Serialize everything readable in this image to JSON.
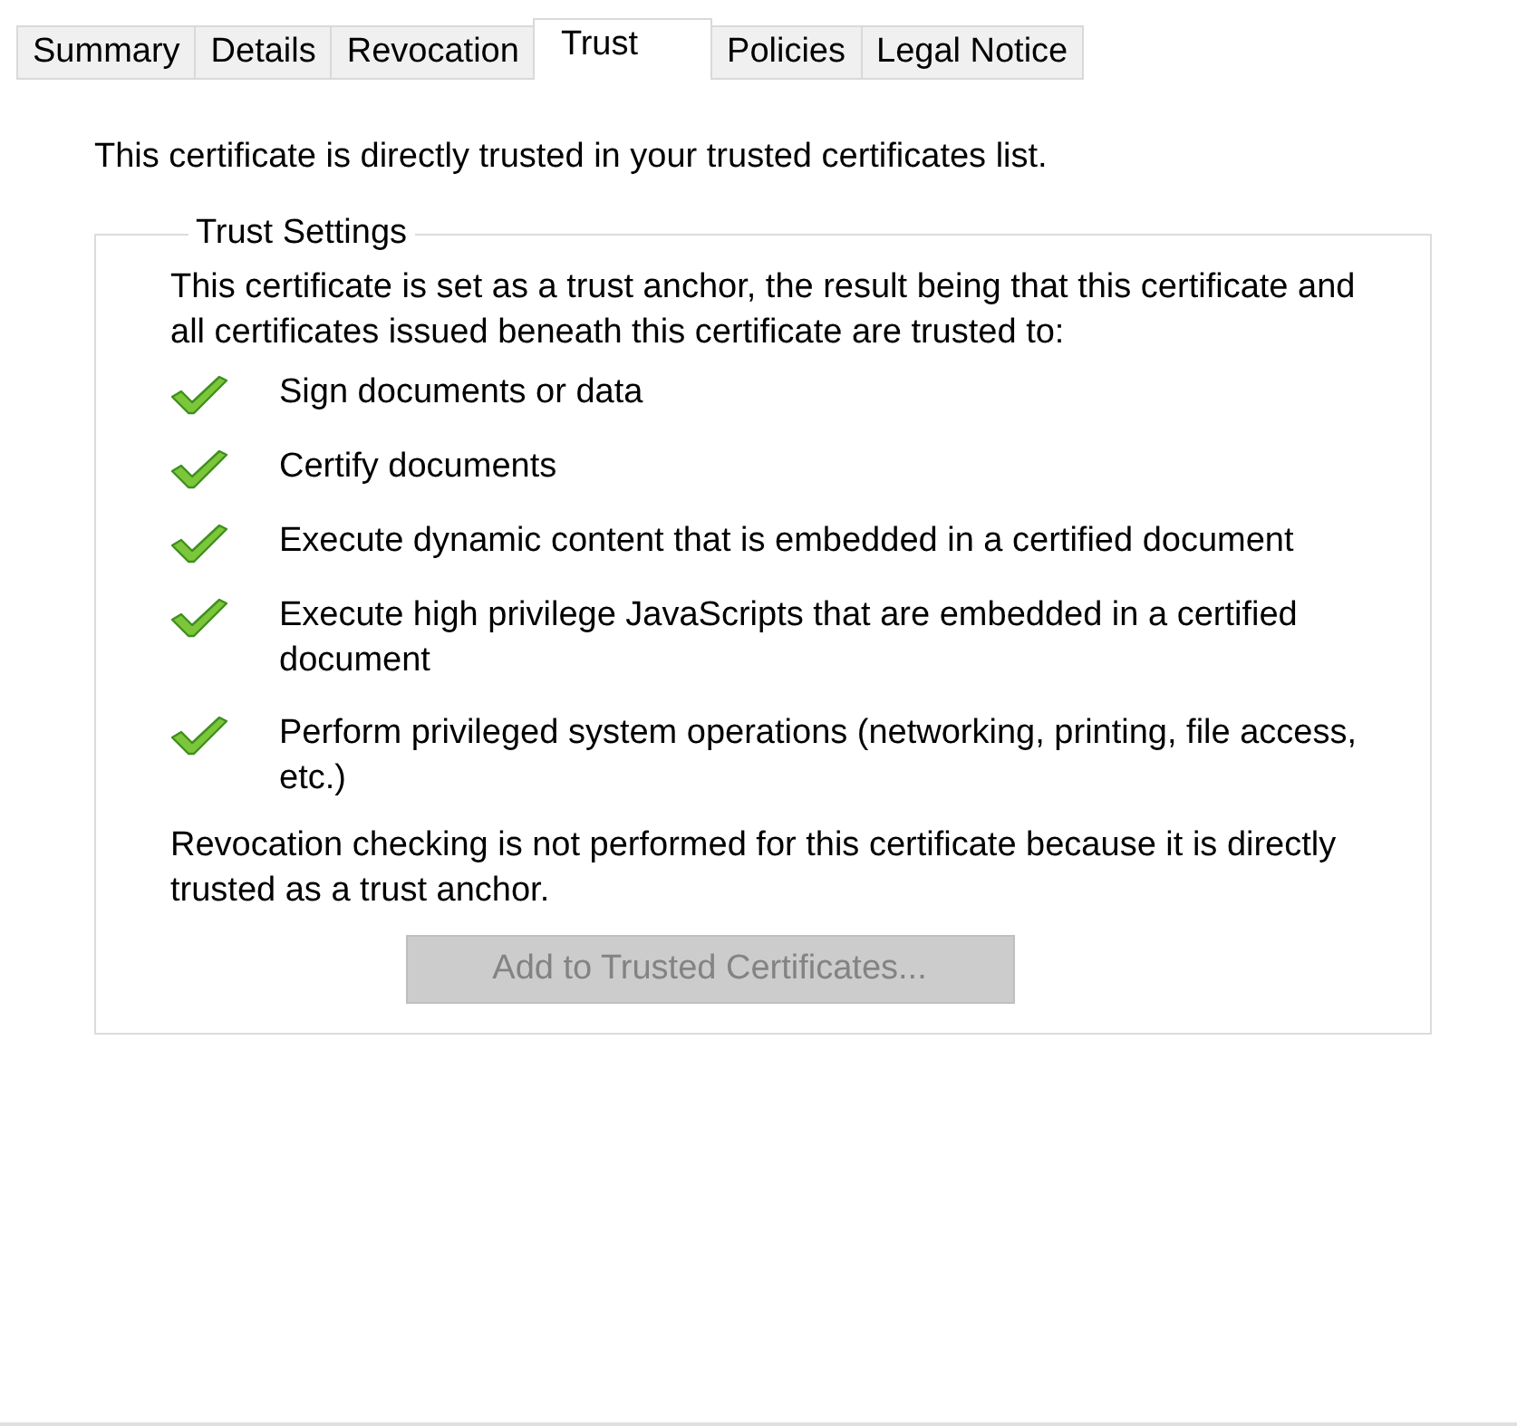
{
  "tabs": [
    {
      "label": "Summary",
      "selected": false
    },
    {
      "label": "Details",
      "selected": false
    },
    {
      "label": "Revocation",
      "selected": false
    },
    {
      "label": "Trust",
      "selected": true
    },
    {
      "label": "Policies",
      "selected": false
    },
    {
      "label": "Legal Notice",
      "selected": false
    }
  ],
  "intro": "This certificate is directly trusted in your trusted certificates list.",
  "group": {
    "title": "Trust Settings",
    "description": "This certificate is set as a trust anchor, the result being that this certificate and all certificates issued beneath this certificate are trusted to:",
    "permissions": [
      {
        "label": "Sign documents or data",
        "checked": true
      },
      {
        "label": "Certify documents",
        "checked": true
      },
      {
        "label": "Execute dynamic content that is embedded in a certified document",
        "checked": true
      },
      {
        "label": "Execute high privilege JavaScripts that are embedded in a certified document",
        "checked": true
      },
      {
        "label": "Perform privileged system operations (networking, printing, file access, etc.)",
        "checked": true
      }
    ],
    "note": "Revocation checking is not performed for this certificate because it is directly trusted as a trust anchor.",
    "button": {
      "label": "Add to Trusted Certificates...",
      "disabled": true
    }
  }
}
